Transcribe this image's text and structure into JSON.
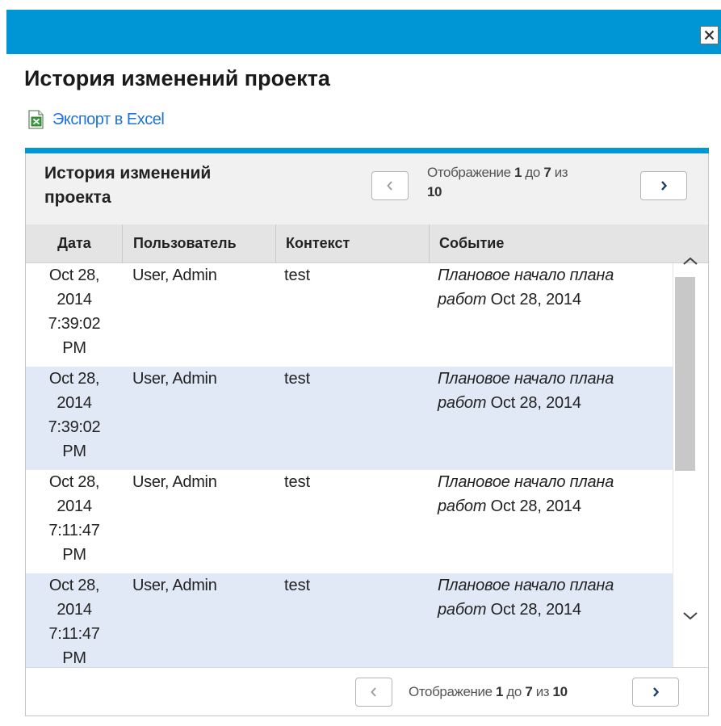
{
  "dialog": {
    "title": "История изменений проекта",
    "close_icon": "close-icon"
  },
  "export": {
    "label": "Экспорт в Excel",
    "icon": "excel-icon"
  },
  "panel": {
    "title": "История изменений проекта",
    "pager_top": {
      "prefix": "Отображение ",
      "from": "1",
      "middle": " до ",
      "to": "7",
      "of_label": " из",
      "total": "10"
    },
    "pager_bottom": {
      "prefix": "Отображение ",
      "from": "1",
      "middle": " до ",
      "to": "7",
      "of_label": " из ",
      "total": "10"
    }
  },
  "table": {
    "columns": [
      "Дата",
      "Пользователь",
      "Контекст",
      "Событие"
    ],
    "rows": [
      {
        "date_1": "Oct 28,",
        "date_2": "2014",
        "date_3": "7:39:02",
        "date_4": "PM",
        "user": "User, Admin",
        "context": "test",
        "event_italic": "Плановое начало плана работ",
        "event_rest": " Oct 28, 2014"
      },
      {
        "date_1": "Oct 28,",
        "date_2": "2014",
        "date_3": "7:39:02",
        "date_4": "PM",
        "user": "User, Admin",
        "context": "test",
        "event_italic": "Плановое начало плана работ",
        "event_rest": " Oct 28, 2014"
      },
      {
        "date_1": "Oct 28,",
        "date_2": "2014",
        "date_3": "7:11:47",
        "date_4": "PM",
        "user": "User, Admin",
        "context": "test",
        "event_italic": "Плановое начало плана работ",
        "event_rest": " Oct 28, 2014"
      },
      {
        "date_1": "Oct 28,",
        "date_2": "2014",
        "date_3": "7:11:47",
        "date_4": "PM",
        "user": "User, Admin",
        "context": "test",
        "event_italic": "Плановое начало плана работ",
        "event_rest": " Oct 28, 2014"
      }
    ]
  },
  "colors": {
    "accent": "#0096d6",
    "link": "#1f73d6",
    "row_alt": "#e1e9f7",
    "header_bg": "#f1f1f1"
  }
}
